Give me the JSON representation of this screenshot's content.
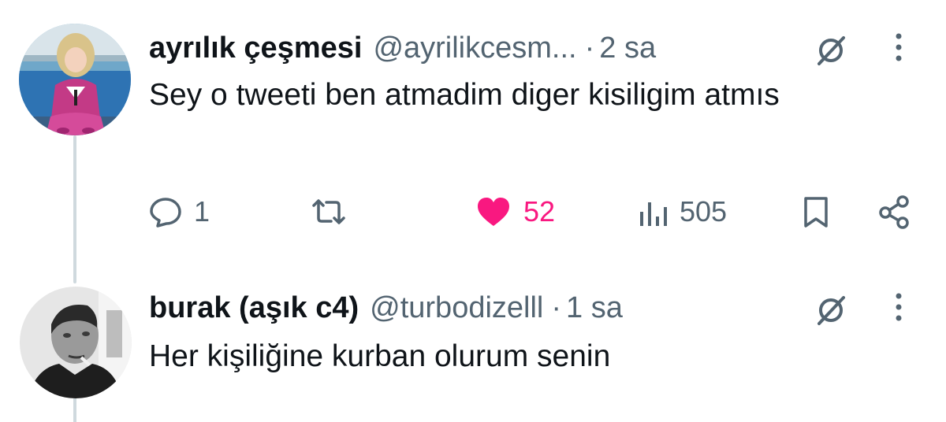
{
  "tweets": [
    {
      "display_name": "ayrılık çeşmesi",
      "handle": "@ayrilikcesm...",
      "separator": "·",
      "time": "2 sa",
      "text": "Sey o tweeti ben atmadim diger kisiligim atmıs",
      "actions": {
        "replies": "1",
        "likes": "52",
        "views": "505"
      }
    },
    {
      "display_name": "burak (aşık c4)",
      "handle": "@turbodizelll",
      "separator": "·",
      "time": "1 sa",
      "text": "Her kişiliğine kurban olurum senin"
    }
  ],
  "colors": {
    "like": "#f91880",
    "secondary_text": "#536471",
    "primary_text": "#0f1419",
    "thread_line": "#cfd9de"
  },
  "icons": [
    "reply-icon",
    "retweet-icon",
    "heart-icon",
    "views-icon",
    "bookmark-icon",
    "share-icon",
    "grok-icon",
    "more-icon"
  ]
}
